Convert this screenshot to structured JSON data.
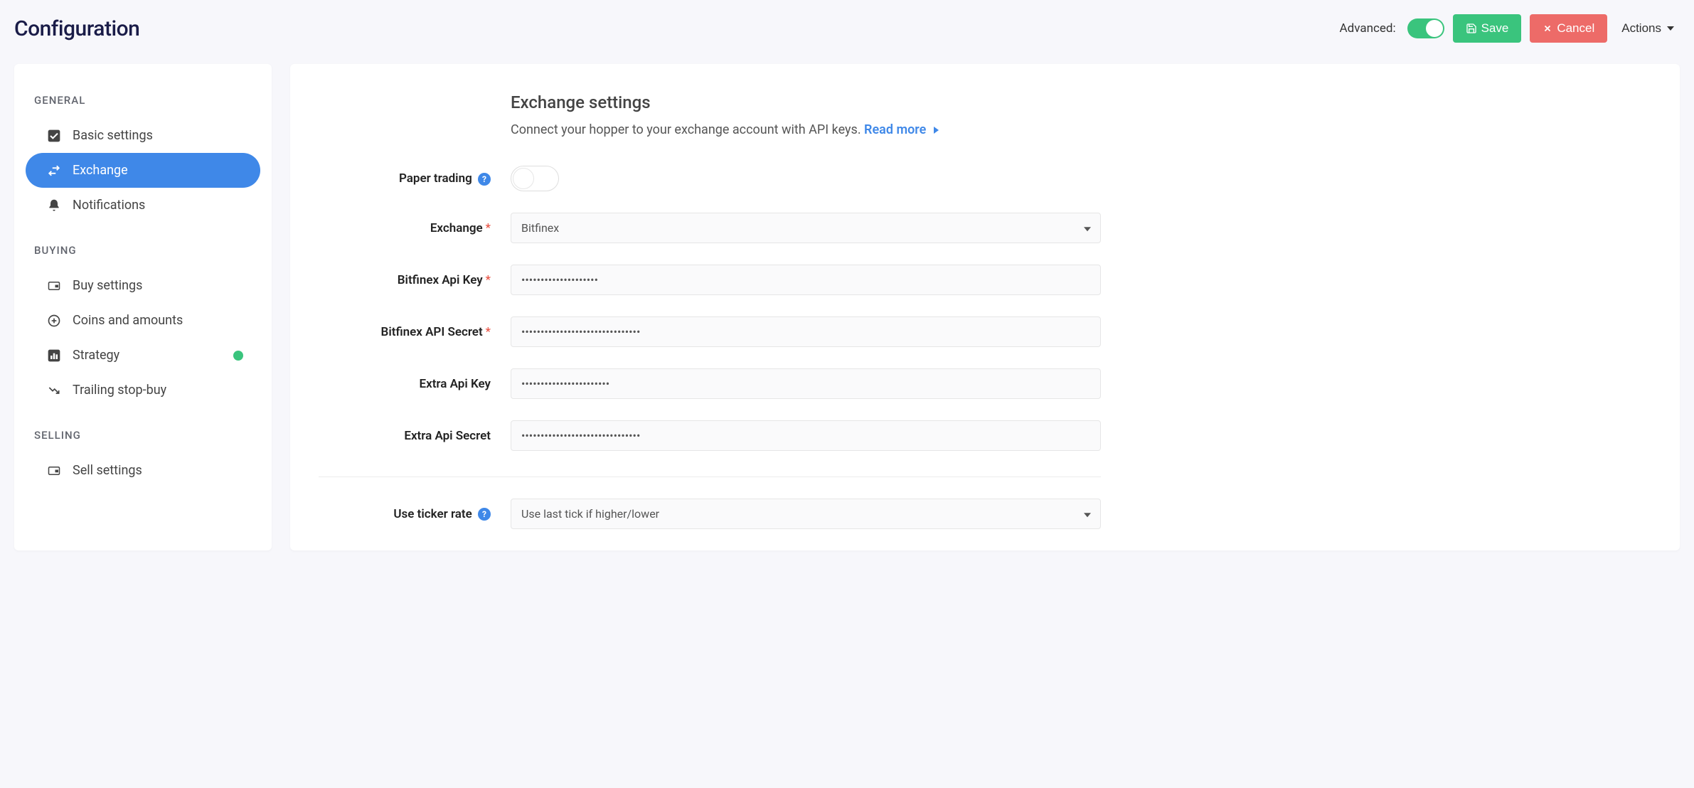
{
  "header": {
    "title": "Configuration",
    "advanced_label": "Advanced:",
    "save_label": "Save",
    "cancel_label": "Cancel",
    "actions_label": "Actions"
  },
  "sidebar": {
    "sections": [
      {
        "header": "GENERAL",
        "items": [
          {
            "label": "Basic settings",
            "icon": "checkbox-checked",
            "active": false
          },
          {
            "label": "Exchange",
            "icon": "swap-horizontal",
            "active": true
          },
          {
            "label": "Notifications",
            "icon": "bell",
            "active": false
          }
        ]
      },
      {
        "header": "BUYING",
        "items": [
          {
            "label": "Buy settings",
            "icon": "wallet-in",
            "active": false
          },
          {
            "label": "Coins and amounts",
            "icon": "plus-circle",
            "active": false
          },
          {
            "label": "Strategy",
            "icon": "bar-chart",
            "active": false,
            "dot": true
          },
          {
            "label": "Trailing stop-buy",
            "icon": "trending-down",
            "active": false
          }
        ]
      },
      {
        "header": "SELLING",
        "items": [
          {
            "label": "Sell settings",
            "icon": "wallet-out",
            "active": false
          }
        ]
      }
    ]
  },
  "main": {
    "title": "Exchange settings",
    "description": "Connect your hopper to your exchange account with API keys.",
    "read_more": "Read more",
    "fields": {
      "paper_trading": {
        "label": "Paper trading",
        "help": true
      },
      "exchange": {
        "label": "Exchange",
        "required": true,
        "value": "Bitfinex"
      },
      "api_key": {
        "label": "Bitfinex Api Key",
        "required": true,
        "value": "••••••••••••••••••••"
      },
      "api_secret": {
        "label": "Bitfinex API Secret",
        "required": true,
        "value": "•••••••••••••••••••••••••••••••"
      },
      "extra_api_key": {
        "label": "Extra Api Key",
        "required": false,
        "value": "•••••••••••••••••••••••"
      },
      "extra_api_secret": {
        "label": "Extra Api Secret",
        "required": false,
        "value": "•••••••••••••••••••••••••••••••"
      },
      "ticker_rate": {
        "label": "Use ticker rate",
        "help": true,
        "value": "Use last tick if higher/lower"
      }
    }
  }
}
